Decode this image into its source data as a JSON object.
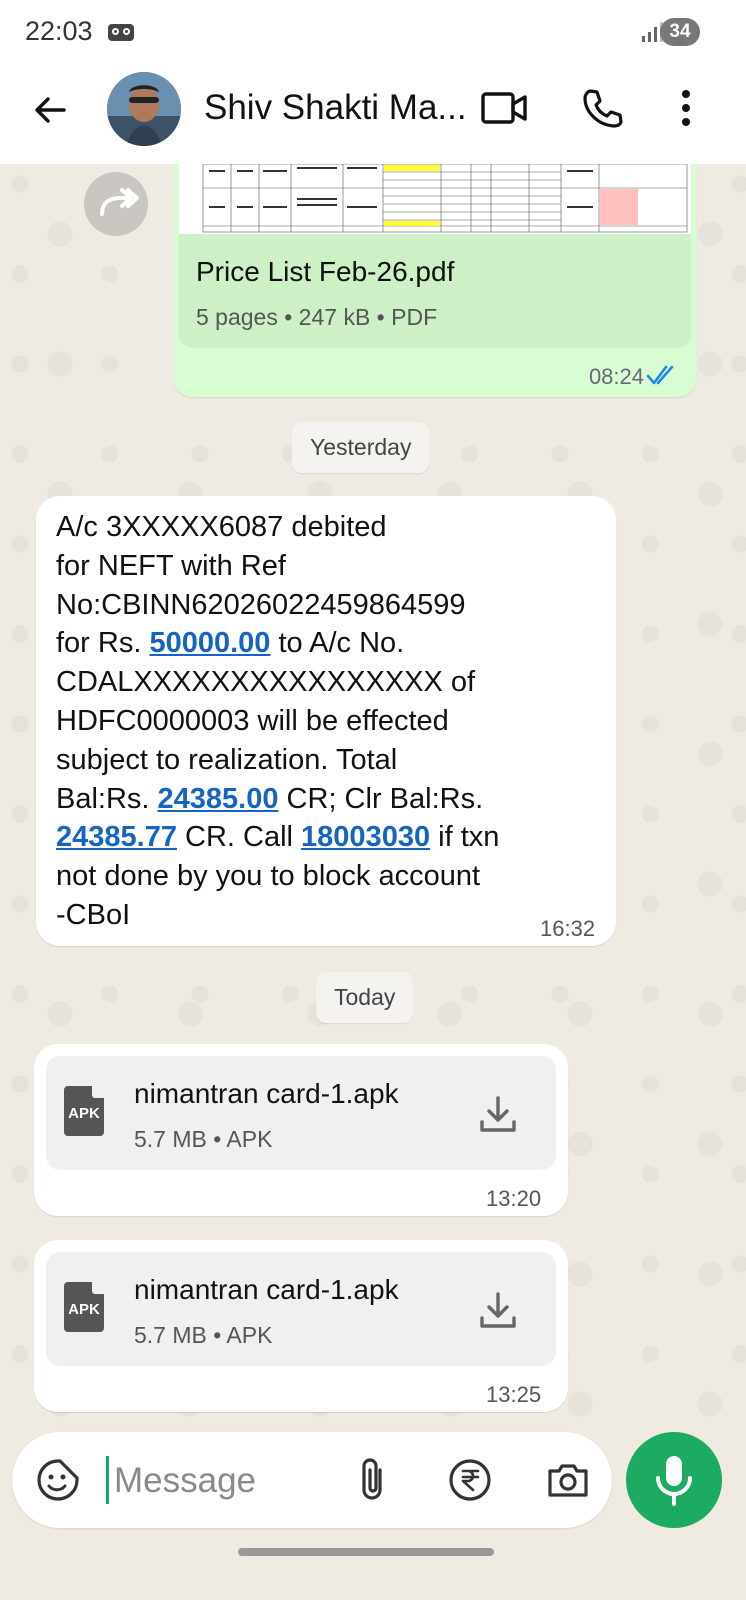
{
  "status_bar": {
    "time": "22:03",
    "battery": "34"
  },
  "header": {
    "contact_name": "Shiv Shakti Ma..."
  },
  "messages": {
    "pdf": {
      "file_name": "Price List Feb-26.pdf",
      "meta": "5 pages • 247 kB • PDF",
      "time": "08:24"
    },
    "date_yesterday": "Yesterday",
    "sms": {
      "lines": [
        [
          "A/c 3XXXXX6087 debited"
        ],
        [
          "for NEFT with Ref"
        ],
        [
          "No:CBINN62026022459864599"
        ],
        [
          "for Rs.         ",
          "50000.00",
          " to A/c No."
        ],
        [
          "CDALXXXXXXXXXXXXXXXX of"
        ],
        [
          "HDFC0000003  will be effected"
        ],
        [
          "subject to realization. Total"
        ],
        [
          "Bal:Rs.         ",
          "24385.00",
          " CR; Clr Bal:Rs."
        ],
        [
          "24385.77",
          " CR. Call ",
          "18003030",
          " if txn"
        ],
        [
          "not done by you to block account"
        ],
        [
          "-CBoI"
        ]
      ],
      "time": "16:32"
    },
    "date_today": "Today",
    "apk1": {
      "file_name": "nimantran card-1.apk",
      "meta": "5.7 MB • APK",
      "badge": "APK",
      "time": "13:20"
    },
    "apk2": {
      "file_name": "nimantran card-1.apk",
      "meta": "5.7 MB • APK",
      "badge": "APK",
      "time": "13:25"
    }
  },
  "composer": {
    "placeholder": "Message"
  },
  "icons": {
    "back": "arrow-left-icon",
    "video": "video-camera-icon",
    "call": "phone-icon",
    "more": "more-vertical-icon",
    "forward": "forward-icon",
    "emoji": "sticker-icon",
    "attach": "paperclip-icon",
    "payment": "rupee-icon",
    "camera": "camera-icon",
    "mic": "mic-icon",
    "download": "download-icon",
    "read": "double-check-icon"
  },
  "colors": {
    "accent": "#1daa61",
    "outgoing_bubble": "#d9fdd3",
    "link": "#1565c0",
    "read_tick": "#1e88e5"
  }
}
